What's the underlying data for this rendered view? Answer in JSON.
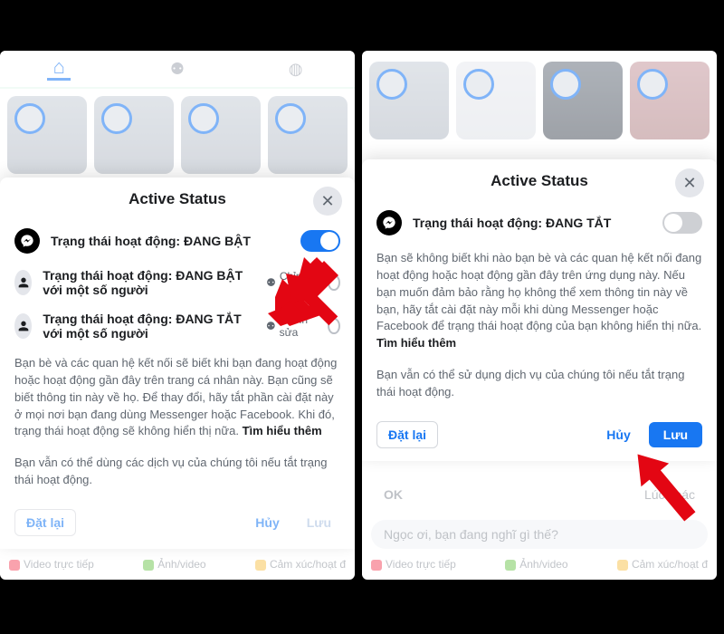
{
  "panels": {
    "left": {
      "modal": {
        "title": "Active Status",
        "main_toggle_label": "Trạng thái hoạt động: ĐANG BẬT",
        "main_toggle_on": true,
        "option_on_some": "Trạng thái hoạt động: ĐANG BẬT với một số người",
        "option_off_some": "Trạng thái hoạt động: ĐANG TẮT với một số người",
        "edit_label": "Chỉnh sửa",
        "desc_1": "Bạn bè và các quan hệ kết nối sẽ biết khi bạn đang hoạt động hoặc hoạt động gần đây trên trang cá nhân này. Bạn cũng sẽ biết thông tin này về họ. Để thay đổi, hãy tắt phần cài đặt này ở mọi nơi bạn đang dùng Messenger hoặc Facebook. Khi đó, trạng thái hoạt động sẽ không hiển thị nữa. ",
        "desc_1_bold": "Tìm hiểu thêm",
        "desc_2": "Bạn vẫn có thể dùng các dịch vụ của chúng tôi nếu tắt trạng thái hoạt động.",
        "btn_reset": "Đặt lại",
        "btn_cancel": "Hủy",
        "btn_save": "Lưu"
      }
    },
    "right": {
      "modal": {
        "title": "Active Status",
        "main_toggle_label": "Trạng thái hoạt động: ĐANG TẮT",
        "main_toggle_on": false,
        "desc_1": "Bạn sẽ không biết khi nào bạn bè và các quan hệ kết nối đang hoạt động hoặc hoạt động gần đây trên ứng dụng này. Nếu bạn muốn đảm bảo rằng họ không thể xem thông tin này về bạn, hãy tắt cài đặt này mỗi khi dùng Messenger hoặc Facebook để trạng thái hoạt động của bạn không hiển thị nữa. ",
        "desc_1_bold": "Tìm hiểu thêm",
        "desc_2": "Bạn vẫn có thể sử dụng dịch vụ của chúng tôi nếu tắt trạng thái hoạt động.",
        "btn_reset": "Đặt lại",
        "btn_cancel": "Hủy",
        "btn_save": "Lưu"
      },
      "confirm_ok": "OK",
      "confirm_later": "Lúc khác"
    },
    "backdrop": {
      "composer_placeholder": "Ngọc ơi, bạn đang nghĩ gì thế?",
      "action_video": "Video trực tiếp",
      "action_photo": "Ảnh/video",
      "action_emoji": "Cảm xúc/hoạt đ"
    }
  }
}
